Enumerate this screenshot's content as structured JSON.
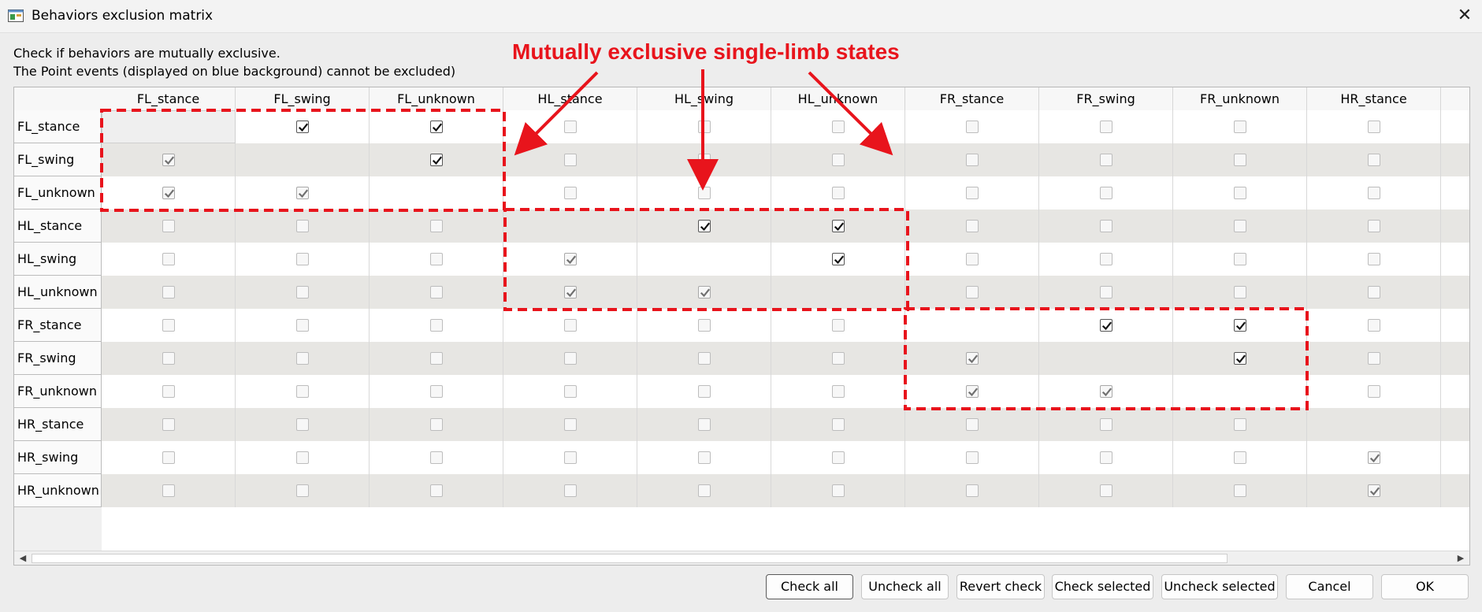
{
  "window": {
    "title": "Behaviors exclusion matrix",
    "close_glyph": "✕",
    "app_icon": "app-window-icon",
    "close_icon": "close-icon"
  },
  "description": {
    "line1": "Check if behaviors are mutually exclusive.",
    "line2": "The Point events (displayed on blue background) cannot be excluded)"
  },
  "annotation": {
    "title": "Mutually exclusive single-limb states",
    "color": "#e8141c"
  },
  "matrix": {
    "columns": [
      "FL_stance",
      "FL_swing",
      "FL_unknown",
      "HL_stance",
      "HL_swing",
      "HL_unknown",
      "FR_stance",
      "FR_swing",
      "FR_unknown",
      "HR_stance"
    ],
    "rows": [
      "FL_stance",
      "FL_swing",
      "FL_unknown",
      "HL_stance",
      "HL_swing",
      "HL_unknown",
      "FR_stance",
      "FR_swing",
      "FR_unknown",
      "HR_stance",
      "HR_swing",
      "HR_unknown"
    ],
    "checked_editable": [
      [
        0,
        1
      ],
      [
        0,
        2
      ],
      [
        1,
        2
      ],
      [
        3,
        4
      ],
      [
        3,
        5
      ],
      [
        4,
        5
      ],
      [
        6,
        7
      ],
      [
        6,
        8
      ],
      [
        7,
        8
      ]
    ],
    "checked_mirrored": [
      [
        1,
        0
      ],
      [
        2,
        0
      ],
      [
        2,
        1
      ],
      [
        4,
        3
      ],
      [
        5,
        3
      ],
      [
        5,
        4
      ],
      [
        7,
        6
      ],
      [
        8,
        6
      ],
      [
        8,
        7
      ],
      [
        10,
        9
      ],
      [
        11,
        9
      ]
    ]
  },
  "buttons": {
    "check_all": "Check all",
    "uncheck_all": "Uncheck all",
    "revert_check": "Revert check",
    "check_selected": "Check selected",
    "uncheck_selected": "Uncheck selected",
    "cancel": "Cancel",
    "ok": "OK"
  },
  "scrollbar": {
    "left_arrow": "◀",
    "right_arrow": "▶"
  }
}
